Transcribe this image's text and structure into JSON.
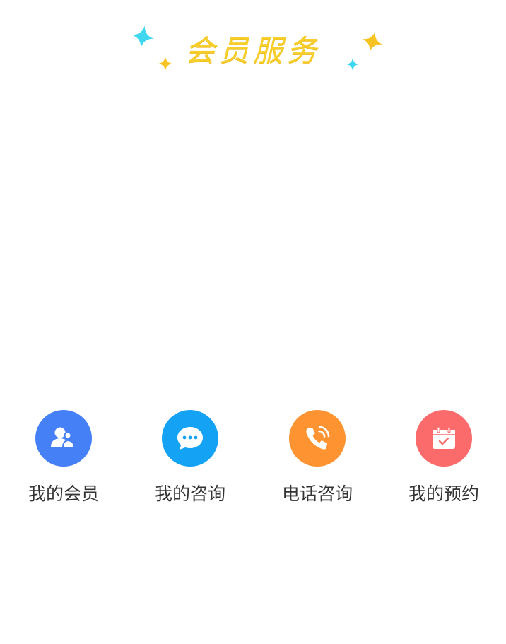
{
  "header": {
    "title": "会员服务"
  },
  "colors": {
    "title": "#f6cf2c",
    "sparkle_cyan": "#3fd6f0",
    "sparkle_yellow": "#f7c322",
    "label": "#333333"
  },
  "services": [
    {
      "label": "我的会员",
      "icon": "member-icon",
      "color": "#4580f7"
    },
    {
      "label": "我的咨询",
      "icon": "chat-bubble-icon",
      "color": "#14a2f5"
    },
    {
      "label": "电话咨询",
      "icon": "phone-call-icon",
      "color": "#fd9331"
    },
    {
      "label": "我的预约",
      "icon": "calendar-check-icon",
      "color": "#fb6b6b"
    }
  ]
}
